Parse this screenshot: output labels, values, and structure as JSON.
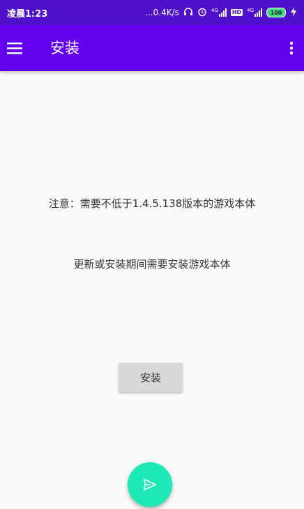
{
  "status_bar": {
    "time": "凌晨1:23",
    "net_speed": "...0.4K/s",
    "signal1_label": "4G",
    "hd_label": "HD",
    "signal2_label": "4G",
    "battery": "100"
  },
  "app_bar": {
    "title": "安装"
  },
  "content": {
    "notice": "注意：需要不低于1.4.5.138版本的游戏本体",
    "info": "更新或安装期间需要安装游戏本体",
    "install_button": "安装"
  },
  "colors": {
    "status_bar": "#4f10c9",
    "app_bar": "#6200ee",
    "fab": "#1de9b6",
    "background": "#fafafa"
  },
  "icons": {
    "menu": "menu-icon",
    "overflow": "more-vert-icon",
    "fab": "send-icon",
    "headset": "headset-icon",
    "alarm": "alarm-icon",
    "charging": "charging-icon"
  }
}
